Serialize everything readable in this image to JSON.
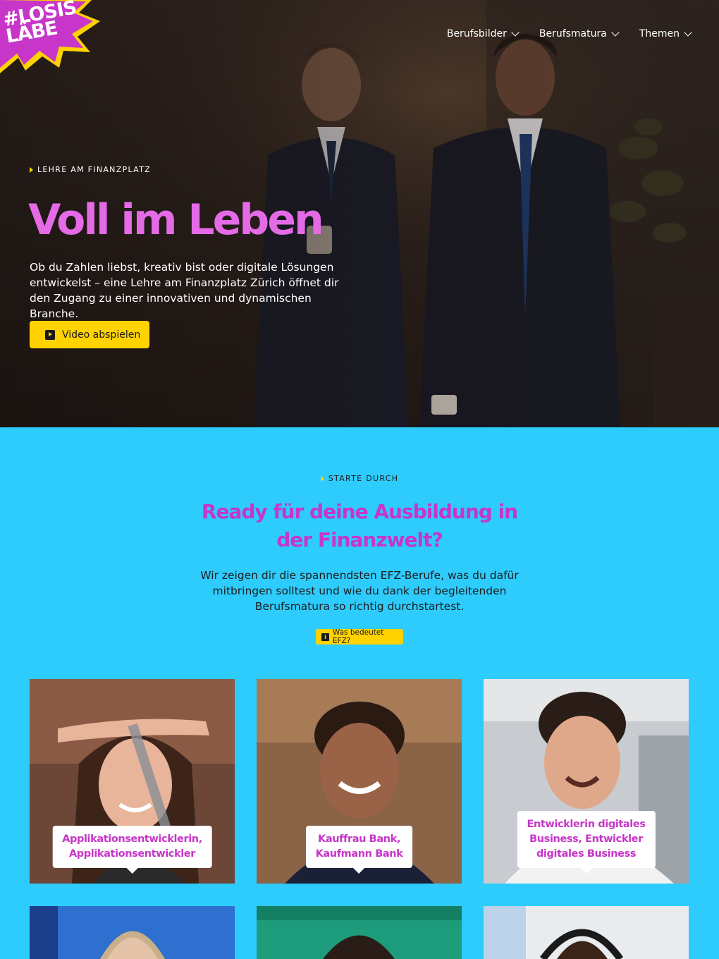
{
  "brand": {
    "logo_text": "#LOSIS LÄBE",
    "logo_lines": [
      "#LOSIS",
      "LÄBE"
    ],
    "accent": "#c736c9",
    "hero_title_color": "#e46ae6",
    "button_color": "#ffd200",
    "section_bg": "#2ecbfd"
  },
  "nav": [
    {
      "label": "Berufsbilder"
    },
    {
      "label": "Berufsmatura"
    },
    {
      "label": "Themen"
    }
  ],
  "hero": {
    "eyebrow": "LEHRE AM FINANZPLATZ",
    "title": "Voll im Leben",
    "text": "Ob du Zahlen liebst, kreativ bist oder digitale Lösungen entwickelst – eine Lehre am Finanzplatz Zürich öffnet dir den Zugang zu einer innovativen und dynamischen Branche.",
    "button_label": "Video abspielen"
  },
  "section": {
    "eyebrow": "STARTE DURCH",
    "title_lines": [
      "Ready für deine Ausbildung in",
      "der Finanzwelt?"
    ],
    "text": "Wir zeigen dir die spannendsten EFZ-Berufe, was du dafür mitbringen solltest und wie du dank der begleitenden Berufsmatura so richtig durchstartest.",
    "efz_button_label": "Was bedeutet EFZ?"
  },
  "cards": [
    {
      "lines": [
        "Applikationsentwicklerin,",
        "Applikationsentwickler"
      ]
    },
    {
      "lines": [
        "Kauffrau Bank,",
        "Kaufmann Bank"
      ]
    },
    {
      "lines": [
        "Entwicklerin digitales",
        "Business, Entwickler",
        "digitales Business"
      ]
    }
  ]
}
